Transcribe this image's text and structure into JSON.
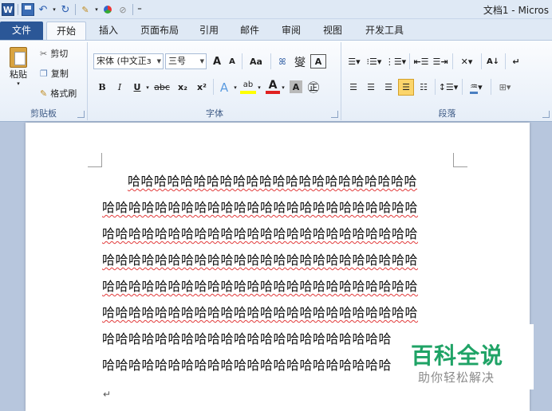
{
  "window": {
    "title": "文档1 - Micros"
  },
  "qat": {
    "app_icon": "W",
    "undo_icon": "↶",
    "redo_icon": "↻",
    "customize": "⁼"
  },
  "tabs": {
    "file": "文件",
    "home": "开始",
    "insert": "插入",
    "layout": "页面布局",
    "references": "引用",
    "mailings": "邮件",
    "review": "审阅",
    "view": "视图",
    "developer": "开发工具"
  },
  "clipboard": {
    "paste": "粘贴",
    "cut": "剪切",
    "copy": "复制",
    "format_painter": "格式刷",
    "label": "剪贴板"
  },
  "font": {
    "name": "宋体 (中文正ɜ",
    "size": "三号",
    "grow": "A",
    "shrink": "A",
    "case": "Aa",
    "clear": "ꕤ",
    "pinyin": "燮",
    "border": "A",
    "bold": "B",
    "italic": "I",
    "underline": "U",
    "strike": "abc",
    "sub": "x₂",
    "sup": "x²",
    "effect": "A",
    "highlight": "ab",
    "color": "A",
    "shade": "A",
    "enclose": "㊣",
    "label": "字体"
  },
  "paragraph": {
    "label": "段落",
    "sort": "A↓"
  },
  "document": {
    "lines": [
      "哈哈哈哈哈哈哈哈哈哈哈哈哈哈哈哈哈哈哈哈哈哈",
      "哈哈哈哈哈哈哈哈哈哈哈哈哈哈哈哈哈哈哈哈哈哈哈哈",
      "哈哈哈哈哈哈哈哈哈哈哈哈哈哈哈哈哈哈哈哈哈哈哈哈",
      "哈哈哈哈哈哈哈哈哈哈哈哈哈哈哈哈哈哈哈哈哈哈哈哈",
      "哈哈哈哈哈哈哈哈哈哈哈哈哈哈哈哈哈哈哈哈哈哈哈哈",
      "哈哈哈哈哈哈哈哈哈哈哈哈哈哈哈哈哈哈哈哈哈哈哈哈",
      "哈哈哈哈哈哈哈哈哈哈哈哈哈哈哈哈哈哈哈哈哈哈",
      "哈哈哈哈哈哈哈哈哈哈哈哈哈哈哈哈哈哈哈哈哈哈"
    ],
    "paragraph_mark": "↵"
  },
  "watermark": {
    "main": "百科全说",
    "sub": "助你轻松解决"
  },
  "colors": {
    "file_tab": "#2b5797",
    "highlight": "#ffff00",
    "font_color": "#e02020",
    "watermark": "#1fa366"
  }
}
